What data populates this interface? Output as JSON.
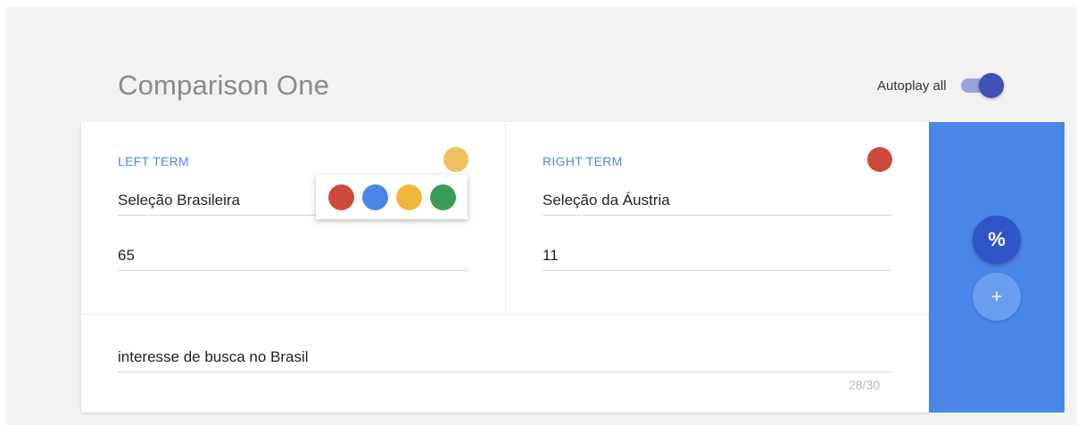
{
  "header": {
    "title": "Comparison One",
    "autoplay_label": "Autoplay all",
    "autoplay_on": true
  },
  "left": {
    "label": "LEFT TERM",
    "term": "Seleção Brasileira",
    "value": "65",
    "color": "#f0c060"
  },
  "right": {
    "label": "RIGHT TERM",
    "term": "Seleção da Áustria",
    "value": "11",
    "color": "#cc4a3a"
  },
  "color_picker": {
    "options": [
      "#d04a3c",
      "#4a86e8",
      "#f0b73a",
      "#3a9d57"
    ]
  },
  "description": {
    "text": "interesse de busca no Brasil",
    "counter": "28/30"
  },
  "actions": {
    "percent_label": "%",
    "add_label": "+"
  }
}
